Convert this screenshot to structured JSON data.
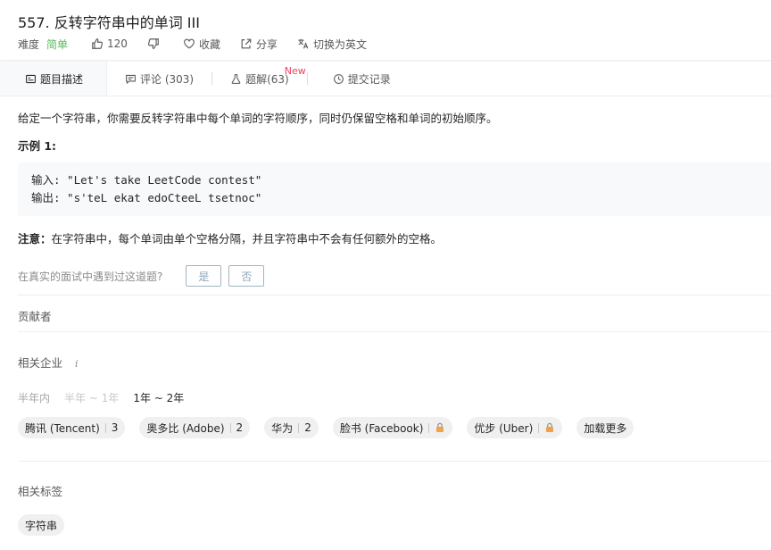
{
  "header": {
    "title": "557. 反转字符串中的单词 III",
    "difficulty_label": "难度",
    "difficulty": "简单",
    "likes": "120",
    "favorite_label": "收藏",
    "share_label": "分享",
    "switch_lang_label": "切换为英文",
    "colors": {
      "difficulty": "#5cb85c",
      "new_badge": "#f43f5e"
    }
  },
  "tabs": [
    {
      "label": "题目描述",
      "icon": "description-icon"
    },
    {
      "label": "评论 (303)",
      "icon": "comment-icon"
    },
    {
      "label": "题解(63)",
      "icon": "flask-icon",
      "badge": "New"
    },
    {
      "label": "提交记录",
      "icon": "clock-icon"
    }
  ],
  "problem": {
    "description": "给定一个字符串，你需要反转字符串中每个单词的字符顺序，同时仍保留空格和单词的初始顺序。",
    "example_title": "示例 1:",
    "example_lines": [
      "输入: \"Let's take LeetCode contest\"",
      "输出: \"s'teL ekat edoCteeL tsetnoc\""
    ],
    "note_label": "注意：",
    "note_text": "在字符串中，每个单词由单个空格分隔，并且字符串中不会有任何额外的空格。"
  },
  "interview": {
    "question": "在真实的面试中遇到过这道题?",
    "yes": "是",
    "no": "否"
  },
  "contributors": {
    "label": "贡献者"
  },
  "companies": {
    "label": "相关企业",
    "info_icon": "i",
    "periods": [
      "半年内",
      "半年 ~ 1年",
      "1年 ~ 2年"
    ],
    "items": [
      {
        "name": "腾讯 (Tencent)",
        "count": "3"
      },
      {
        "name": "奥多比 (Adobe)",
        "count": "2"
      },
      {
        "name": "华为",
        "count": "2"
      },
      {
        "name": "脸书 (Facebook)",
        "icon": "lock-icon"
      },
      {
        "name": "优步 (Uber)",
        "icon": "lock-icon"
      }
    ],
    "load_more": "加载更多"
  },
  "tags": {
    "label": "相关标签",
    "items": [
      "字符串"
    ]
  }
}
